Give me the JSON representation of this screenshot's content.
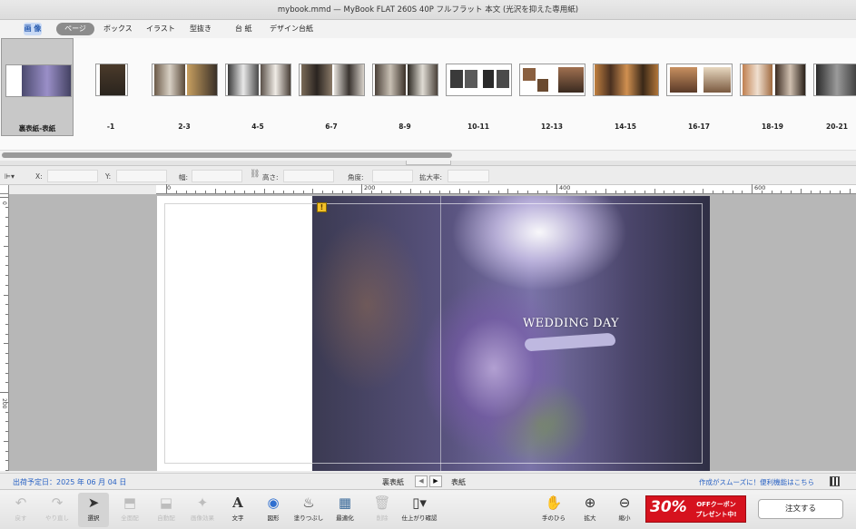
{
  "window": {
    "title": "mybook.mmd — MyBook FLAT 260S 40P フルフラット 本文 (光沢を抑えた専用紙)"
  },
  "tabs": [
    {
      "label": "画 像"
    },
    {
      "label": "ページ"
    },
    {
      "label": "ボックス"
    },
    {
      "label": "イラスト"
    },
    {
      "label": "型抜き"
    },
    {
      "label": "台 紙"
    },
    {
      "label": "デザイン台紙"
    }
  ],
  "strip": {
    "selected_index": 0,
    "pages": [
      {
        "label": "裏表紙-表紙"
      },
      {
        "label": "-1"
      },
      {
        "label": "2-3"
      },
      {
        "label": "4-5"
      },
      {
        "label": "6-7"
      },
      {
        "label": "8-9"
      },
      {
        "label": "10-11"
      },
      {
        "label": "12-13"
      },
      {
        "label": "14-15"
      },
      {
        "label": "16-17"
      },
      {
        "label": "18-19"
      },
      {
        "label": "20-21"
      }
    ]
  },
  "properties": {
    "x_label": "X:",
    "y_label": "Y:",
    "width_label": "幅:",
    "height_label": "高さ:",
    "angle_label": "角度:",
    "zoom_label": "拡大率:"
  },
  "ruler": {
    "top_ticks": [
      "0",
      "200",
      "400",
      "600"
    ],
    "left_ticks": [
      "0",
      "200"
    ]
  },
  "canvas": {
    "headline": "WEDDING DAY",
    "warning_icon": "!"
  },
  "status": {
    "ship_date": "出荷予定日：2025 年 06 月 04 日",
    "nav_left": "裏表紙",
    "nav_right": "表紙",
    "prev_icon": "◀",
    "next_icon": "▶",
    "help_link": "作成がスムーズに！便利機能はこちら"
  },
  "toolbar": {
    "tools": [
      {
        "label": "戻す",
        "icon": "↶",
        "enabled": false
      },
      {
        "label": "やり直し",
        "icon": "↷",
        "enabled": false
      },
      {
        "label": "選択",
        "icon": "➤",
        "enabled": true,
        "active": true
      },
      {
        "label": "全面配",
        "icon": "⬒",
        "enabled": false
      },
      {
        "label": "自動配",
        "icon": "⬓",
        "enabled": false
      },
      {
        "label": "画像効果",
        "icon": "✦",
        "enabled": false
      },
      {
        "label": "文字",
        "icon": "A",
        "enabled": true
      },
      {
        "label": "図形",
        "icon": "◉",
        "enabled": true
      },
      {
        "label": "塗りつぶし",
        "icon": "♨",
        "enabled": true
      },
      {
        "label": "最適化",
        "icon": "▦",
        "enabled": true
      },
      {
        "label": "削除",
        "icon": "🗑",
        "enabled": false
      },
      {
        "label": "仕上がり確認",
        "icon": "▯▾",
        "enabled": true
      },
      {
        "label": "手のひら",
        "icon": "✋",
        "enabled": true
      },
      {
        "label": "拡大",
        "icon": "⊕",
        "enabled": true
      },
      {
        "label": "縮小",
        "icon": "⊖",
        "enabled": true
      }
    ],
    "promo_big": "30%",
    "promo_small_1": "OFFクーポン",
    "promo_small_2": "プレゼント中!",
    "order_button": "注文する"
  }
}
